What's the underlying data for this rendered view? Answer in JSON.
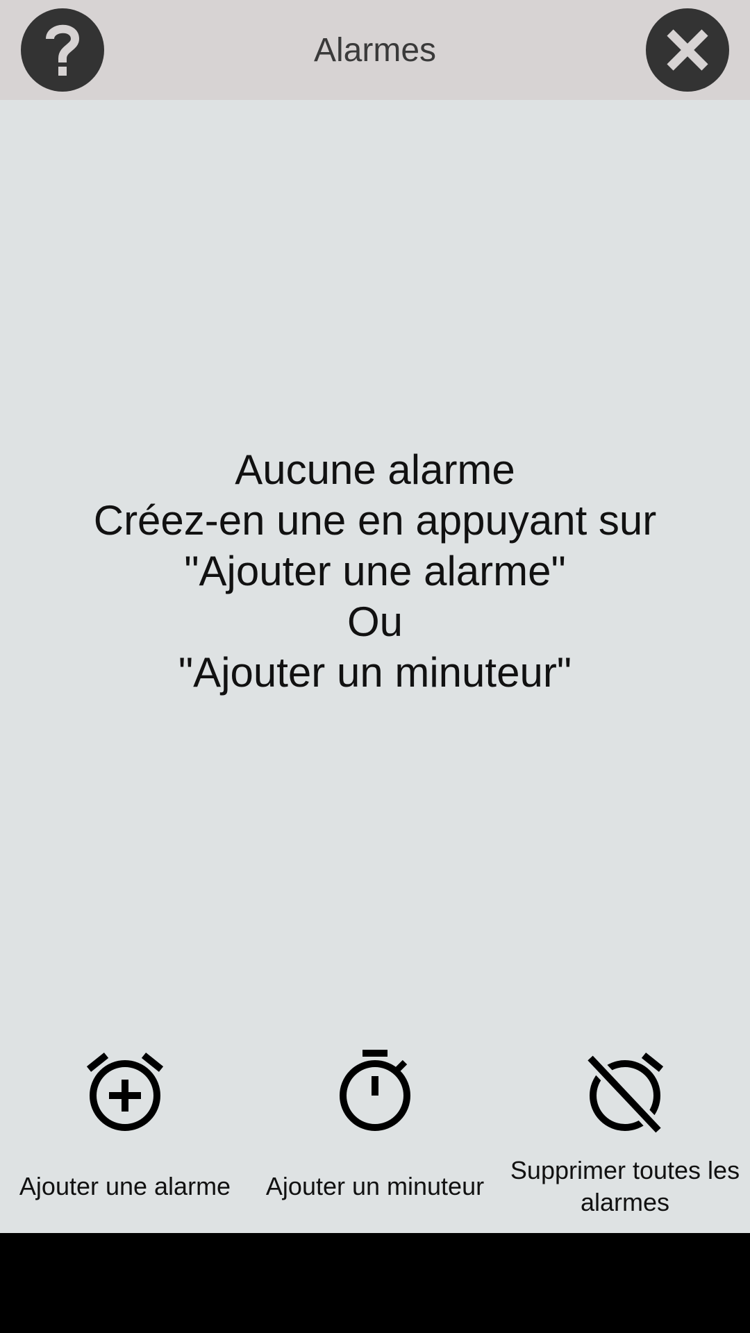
{
  "header": {
    "title": "Alarmes",
    "help_icon": "help-question-icon",
    "close_icon": "close-x-icon"
  },
  "empty_state": {
    "line1": "Aucune alarme",
    "line2": "Créez-en une en appuyant sur",
    "line3": "\"Ajouter une alarme\"",
    "line4": "Ou",
    "line5": "\"Ajouter un minuteur\""
  },
  "actions": [
    {
      "label": "Ajouter une alarme",
      "icon": "alarm-add-icon"
    },
    {
      "label": "Ajouter un minuteur",
      "icon": "timer-icon"
    },
    {
      "label_line1": "Supprimer toutes les",
      "label_line2": "alarmes",
      "icon": "alarm-off-icon"
    }
  ],
  "colors": {
    "background": "#dee2e3",
    "header": "#d7d3d3",
    "round_button": "#333333",
    "nav_bar": "#000000"
  }
}
